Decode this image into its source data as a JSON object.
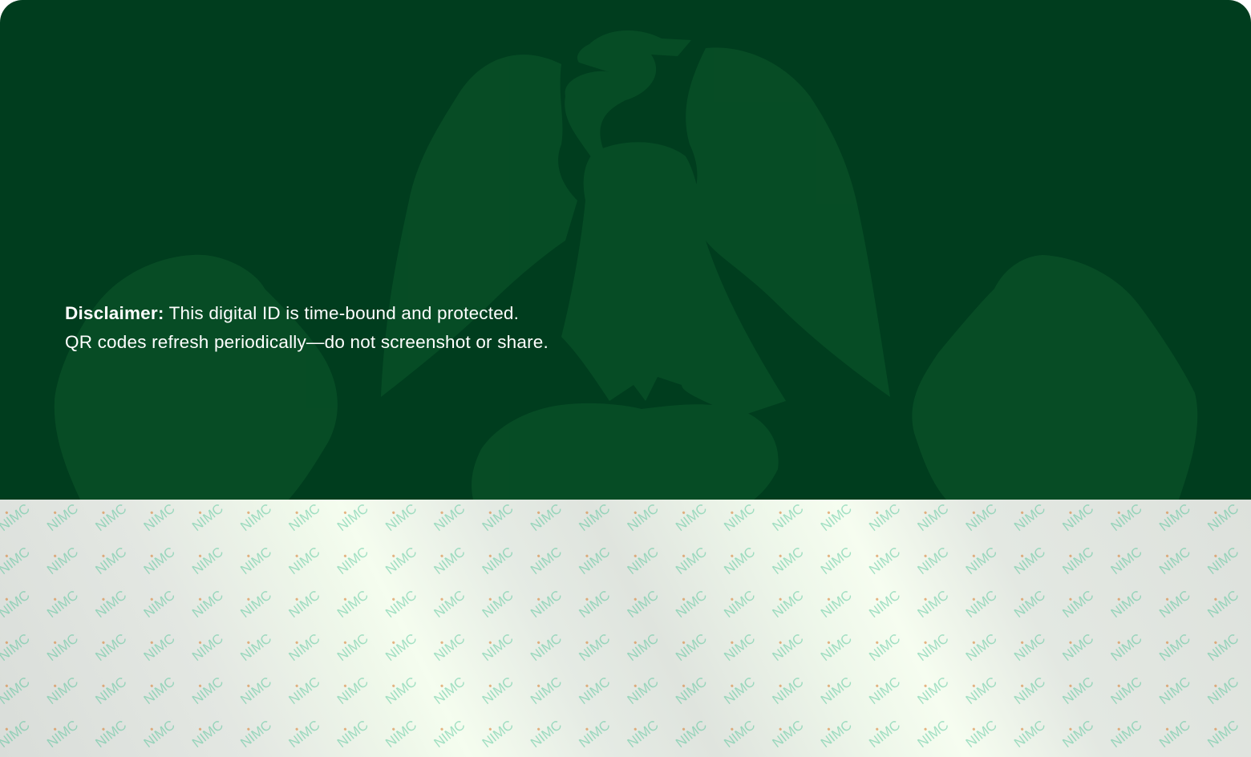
{
  "disclaimer": {
    "label": "Disclaimer:",
    "line1": "This digital ID is time-bound and protected.",
    "line2": "QR codes refresh periodically—do not screenshot or share."
  },
  "watermark": {
    "text": "NIMC"
  },
  "colors": {
    "card_top_background": "#003d1e",
    "coat_of_arms_tint": "#0c5a2c",
    "watermark_text": "#3fbf8f",
    "watermark_mark": "#d97a2a"
  },
  "icons": {
    "emblem": "nigeria-coat-of-arms-icon"
  }
}
